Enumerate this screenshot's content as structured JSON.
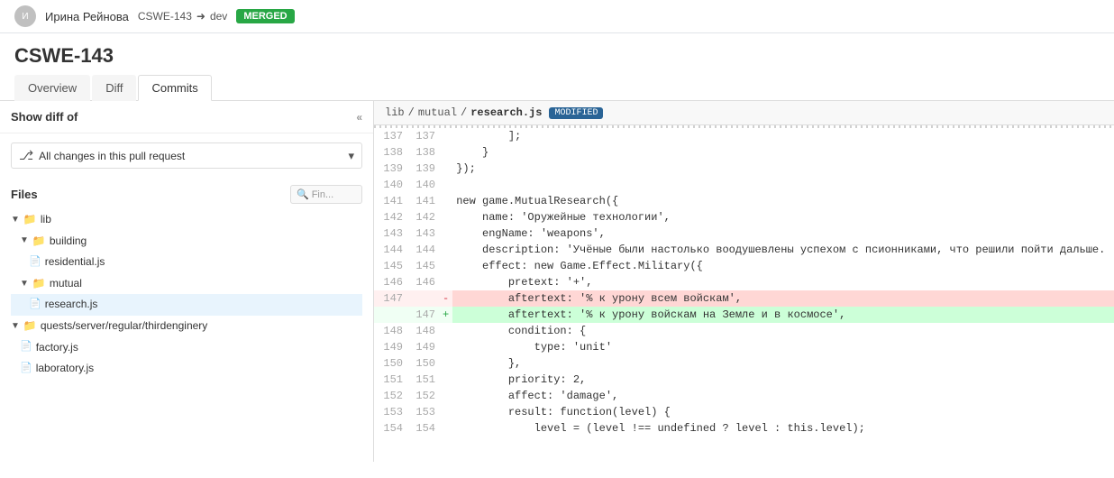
{
  "header": {
    "user": "Ирина Рейнова",
    "branch_from": "CSWE-143",
    "branch_to": "dev",
    "status": "MERGED"
  },
  "pr": {
    "title": "CSWE-143"
  },
  "tabs": [
    {
      "label": "Overview",
      "active": false
    },
    {
      "label": "Diff",
      "active": false
    },
    {
      "label": "Commits",
      "active": true
    }
  ],
  "sidebar": {
    "show_diff_label": "Show diff of",
    "collapse_icon": "«",
    "selector_text": "All changes in this pull request",
    "files_label": "Files",
    "files_search_placeholder": "Fin...",
    "tree": [
      {
        "indent": 0,
        "type": "folder",
        "label": "lib",
        "expanded": true
      },
      {
        "indent": 1,
        "type": "folder",
        "label": "building",
        "expanded": true
      },
      {
        "indent": 2,
        "type": "file",
        "label": "residential.js"
      },
      {
        "indent": 1,
        "type": "folder",
        "label": "mutual",
        "expanded": true
      },
      {
        "indent": 2,
        "type": "file",
        "label": "research.js",
        "selected": true
      },
      {
        "indent": 0,
        "type": "folder",
        "label": "quests/server/regular/thirdenginery",
        "expanded": true
      },
      {
        "indent": 1,
        "type": "file",
        "label": "factory.js"
      },
      {
        "indent": 1,
        "type": "file",
        "label": "laboratory.js"
      }
    ]
  },
  "diff": {
    "path_parts": [
      "lib",
      "/",
      "mutual",
      "/"
    ],
    "file_name": "research.js",
    "badge": "MODIFIED",
    "lines": [
      {
        "left": "137",
        "right": "137",
        "marker": "",
        "content": "        ];"
      },
      {
        "left": "138",
        "right": "138",
        "marker": "",
        "content": "    }"
      },
      {
        "left": "139",
        "right": "139",
        "marker": "",
        "content": "});"
      },
      {
        "left": "140",
        "right": "140",
        "marker": "",
        "content": ""
      },
      {
        "left": "141",
        "right": "141",
        "marker": "",
        "content": "new game.MutualResearch({"
      },
      {
        "left": "142",
        "right": "142",
        "marker": "",
        "content": "    name: 'Оружейные технологии',"
      },
      {
        "left": "143",
        "right": "143",
        "marker": "",
        "content": "    engName: 'weapons',"
      },
      {
        "left": "144",
        "right": "144",
        "marker": "",
        "content": "    description: 'Учёные были настолько воодушевлены успехом с псионниками, что решили пойти дальше."
      },
      {
        "left": "145",
        "right": "145",
        "marker": "",
        "content": "    effect: new Game.Effect.Military({"
      },
      {
        "left": "146",
        "right": "146",
        "marker": "",
        "content": "        pretext: '+',"
      },
      {
        "left": "147",
        "right": "",
        "marker": "-",
        "content": "        aftertext: '% к урону всем войскам',",
        "type": "removed"
      },
      {
        "left": "",
        "right": "147",
        "marker": "+",
        "content": "        aftertext: '% к урону войскам на Земле и в космосе',",
        "type": "added"
      },
      {
        "left": "148",
        "right": "148",
        "marker": "",
        "content": "        condition: {"
      },
      {
        "left": "149",
        "right": "149",
        "marker": "",
        "content": "            type: 'unit'"
      },
      {
        "left": "150",
        "right": "150",
        "marker": "",
        "content": "        },"
      },
      {
        "left": "151",
        "right": "151",
        "marker": "",
        "content": "        priority: 2,"
      },
      {
        "left": "152",
        "right": "152",
        "marker": "",
        "content": "        affect: 'damage',"
      },
      {
        "left": "153",
        "right": "153",
        "marker": "",
        "content": "        result: function(level) {"
      },
      {
        "left": "154",
        "right": "154",
        "marker": "",
        "content": "            level = (level !== undefined ? level : this.level);"
      }
    ]
  }
}
